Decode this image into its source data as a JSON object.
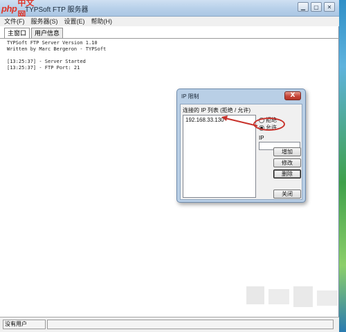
{
  "window": {
    "title": "TYPSoft FTP 服务器"
  },
  "logo": {
    "php": "php",
    "cn": "中文网"
  },
  "window_buttons": [
    "minimize-icon",
    "maximize-icon",
    "close-icon"
  ],
  "menu": [
    "文件(F)",
    "服务器(S)",
    "设置(E)",
    "帮助(H)"
  ],
  "tabs": [
    "主窗口",
    "用户信息"
  ],
  "log": [
    "TYPSoft FTP Server Version 1.10",
    "Written by Marc Bergeron - TYPSoft",
    "",
    "[13:25:37] - Server Started",
    "[13:25:37] - FTP Port: 21"
  ],
  "status": {
    "left": "没有用户"
  },
  "dialog": {
    "title": "IP 限制",
    "close_label": "X",
    "list_caption": "连接的 IP 列表 (拒绝 / 允许)",
    "ip_entries": [
      "192.168.33.130"
    ],
    "radio_deny": "拒绝",
    "radio_allow": "允许",
    "ip_label": "IP",
    "ip_value": "",
    "buttons": {
      "add": "增加",
      "edit": "修改",
      "delete": "删除",
      "close": "关闭"
    }
  },
  "colors": {
    "accent_red": "#c8322b",
    "title_blue": "#b9d1ea"
  }
}
